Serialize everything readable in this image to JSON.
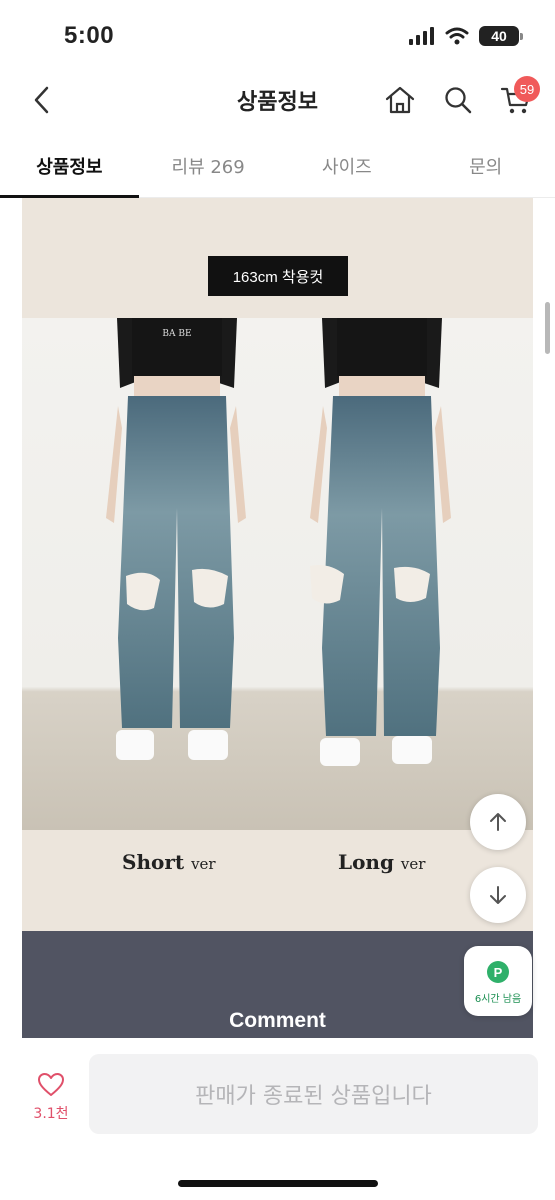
{
  "status_bar": {
    "time": "5:00",
    "battery": "40"
  },
  "header": {
    "title": "상품정보",
    "cart_count": "59"
  },
  "tabs": [
    {
      "label": "상품정보",
      "active": true
    },
    {
      "label": "리뷰 269",
      "active": false
    },
    {
      "label": "사이즈",
      "active": false
    },
    {
      "label": "문의",
      "active": false
    }
  ],
  "product_image": {
    "size_label": "163cm 착용컷",
    "short_label": "Short",
    "short_suffix": "ver",
    "long_label": "Long",
    "long_suffix": "ver",
    "comment_label": "Comment",
    "model_shirt_text": "BA BE"
  },
  "point_card": {
    "badge": "P",
    "label": "6시간 남음"
  },
  "bottom_bar": {
    "like_count": "3.1천",
    "sold_out_label": "판매가 종료된 상품입니다"
  },
  "colors": {
    "accent_red": "#f05a5a",
    "like_pink": "#e0506a",
    "point_green": "#2fb06a",
    "band": "#515462",
    "beige": "#ece5dc"
  },
  "icons": [
    "signal-icon",
    "wifi-icon",
    "battery-icon",
    "back-icon",
    "home-icon",
    "search-icon",
    "cart-icon",
    "arrow-up-icon",
    "arrow-down-icon",
    "heart-icon"
  ]
}
